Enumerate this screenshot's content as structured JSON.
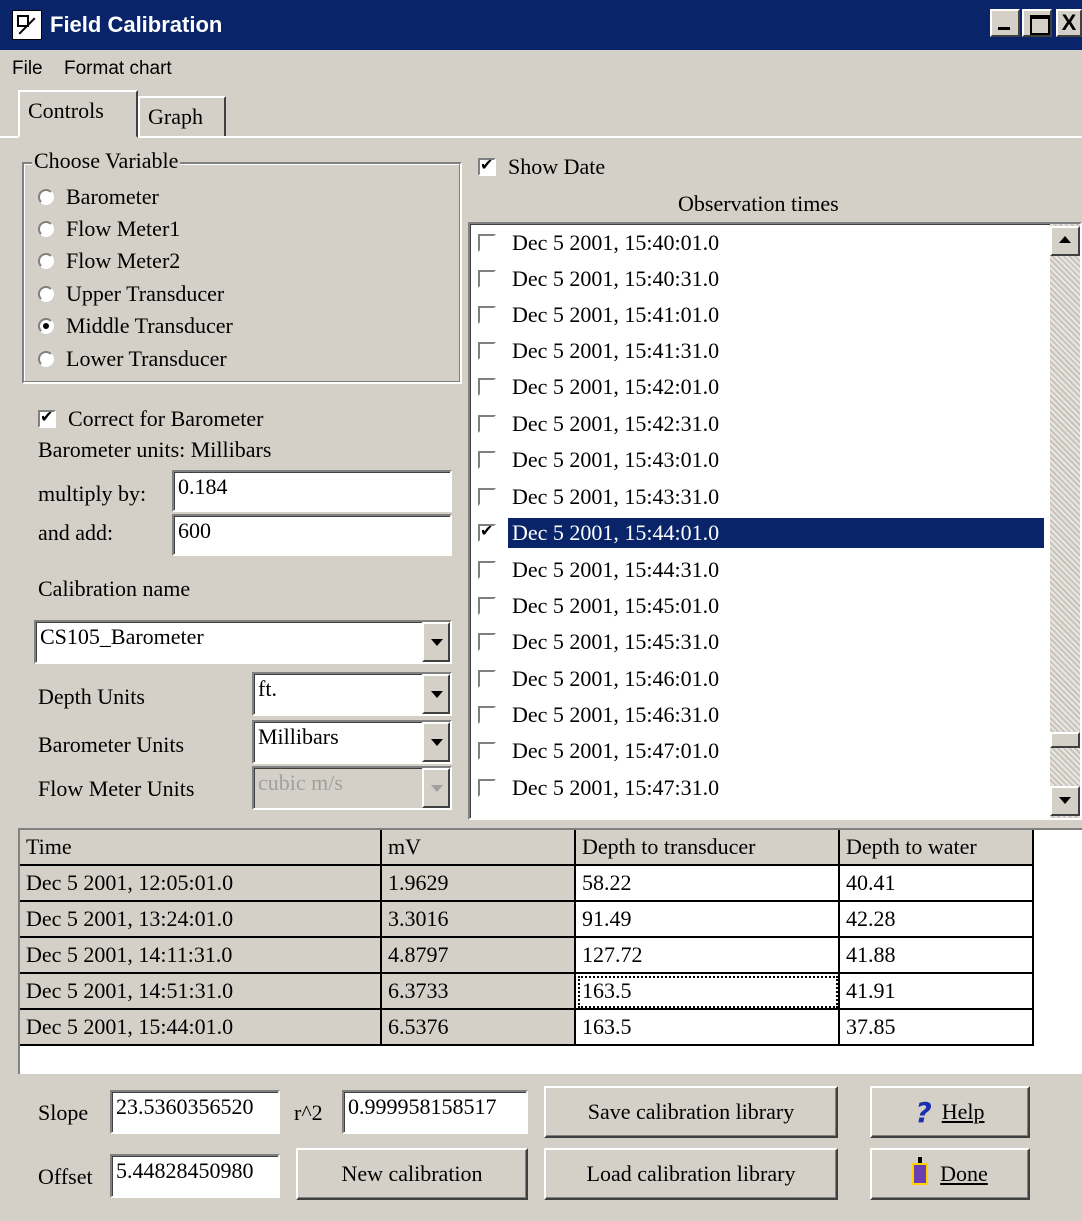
{
  "window": {
    "title": "Field Calibration",
    "app_icon": "chart-icon",
    "close_symbol": "X"
  },
  "menu": {
    "file": "File",
    "format_chart": "Format chart"
  },
  "tabs": [
    {
      "label": "Controls",
      "active": true
    },
    {
      "label": "Graph",
      "active": false
    }
  ],
  "choose_variable": {
    "legend": "Choose Variable",
    "options": [
      "Barometer",
      "Flow Meter1",
      "Flow Meter2",
      "Upper Transducer",
      "Middle Transducer",
      "Lower Transducer"
    ],
    "selected": "Middle Transducer"
  },
  "barometer": {
    "correct_label": "Correct for Barometer",
    "correct_checked": true,
    "units_text": "Barometer units: Millibars",
    "multiply_label": "multiply by:",
    "multiply_value": "0.184",
    "add_label": "and add:",
    "add_value": "600"
  },
  "calibration": {
    "name_label": "Calibration name",
    "name_value": "CS105_Barometer"
  },
  "units": {
    "depth_label": "Depth Units",
    "depth_value": "ft.",
    "barometer_label": "Barometer Units",
    "barometer_value": "Millibars",
    "flow_label": "Flow Meter Units",
    "flow_value": "cubic m/s"
  },
  "observation": {
    "show_date_label": "Show Date",
    "show_date_checked": true,
    "header": "Observation times",
    "times": [
      "Dec 5 2001, 15:40:01.0",
      "Dec 5 2001, 15:40:31.0",
      "Dec 5 2001, 15:41:01.0",
      "Dec 5 2001, 15:41:31.0",
      "Dec 5 2001, 15:42:01.0",
      "Dec 5 2001, 15:42:31.0",
      "Dec 5 2001, 15:43:01.0",
      "Dec 5 2001, 15:43:31.0",
      "Dec 5 2001, 15:44:01.0",
      "Dec 5 2001, 15:44:31.0",
      "Dec 5 2001, 15:45:01.0",
      "Dec 5 2001, 15:45:31.0",
      "Dec 5 2001, 15:46:01.0",
      "Dec 5 2001, 15:46:31.0",
      "Dec 5 2001, 15:47:01.0",
      "Dec 5 2001, 15:47:31.0"
    ],
    "selected_time": "Dec 5 2001, 15:44:01.0"
  },
  "table": {
    "headers": [
      "Time",
      "mV",
      "Depth to transducer",
      "Depth to water"
    ],
    "rows": [
      [
        "Dec 5 2001, 12:05:01.0",
        "1.9629",
        "58.22",
        "40.41"
      ],
      [
        "Dec 5 2001, 13:24:01.0",
        "3.3016",
        "91.49",
        "42.28"
      ],
      [
        "Dec 5 2001, 14:11:31.0",
        "4.8797",
        "127.72",
        "41.88"
      ],
      [
        "Dec 5 2001, 14:51:31.0",
        "6.3733",
        "163.5",
        "41.91"
      ],
      [
        "Dec 5 2001, 15:44:01.0",
        "6.5376",
        "163.5",
        "37.85"
      ]
    ]
  },
  "stats": {
    "slope_label": "Slope",
    "slope_value": "23.5360356520",
    "r2_label": "r^2",
    "r2_value": "0.999958158517",
    "offset_label": "Offset",
    "offset_value": "5.44828450980"
  },
  "buttons": {
    "new_calibration": "New calibration",
    "save_library": "Save calibration library",
    "load_library": "Load calibration library",
    "help": "Help",
    "done": "Done"
  },
  "colors": {
    "titlebar": "#0a246a",
    "face": "#d4d0c8",
    "selection": "#0a246a"
  }
}
